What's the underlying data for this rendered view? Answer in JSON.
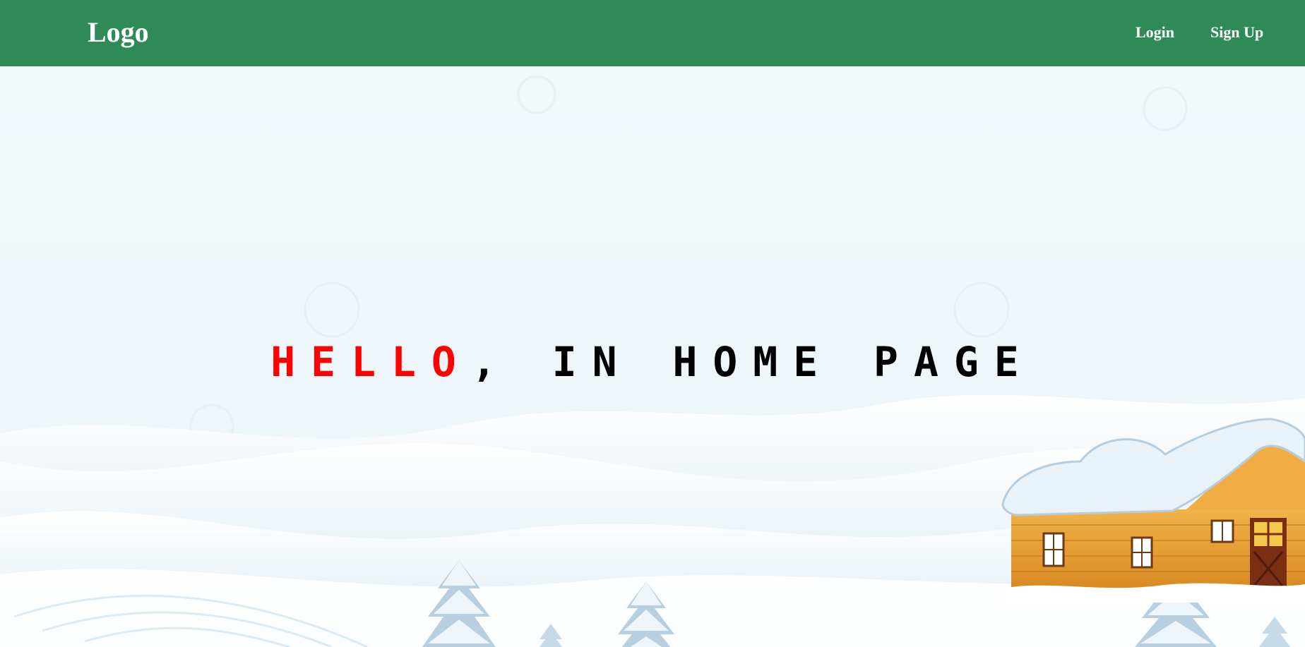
{
  "nav": {
    "logo": "Logo",
    "links": [
      {
        "label": "Login"
      },
      {
        "label": "Sign Up"
      }
    ]
  },
  "hero": {
    "greeting": "HELLO",
    "message": ", IN HOME PAGE"
  },
  "colors": {
    "navbar": "#2e8b57",
    "nav_text": "#ffffff",
    "greeting": "#ff0000",
    "message": "#000000",
    "background": "#f1f8fb"
  },
  "icons": [
    "house-illustration",
    "snow-tree-illustration",
    "snow-hills-illustration"
  ]
}
